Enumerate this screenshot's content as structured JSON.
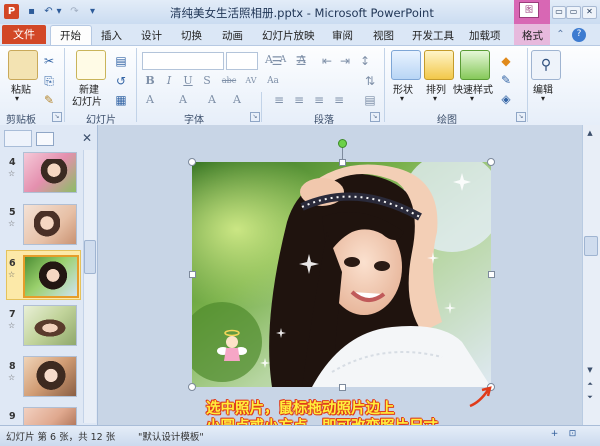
{
  "window": {
    "title": "清纯美女生活照相册.pptx - Microsoft PowerPoint",
    "app_icon": "P",
    "controls": {
      "minimize": "−",
      "restore": "▭",
      "close": "✕"
    },
    "context_tools_label": "图..."
  },
  "quick_access": {
    "save": "💾",
    "undo": "↶",
    "redo": "↷",
    "customize": "▾"
  },
  "tabs": [
    "文件",
    "开始",
    "插入",
    "设计",
    "切换",
    "动画",
    "幻灯片放映",
    "审阅",
    "视图",
    "开发工具",
    "加载项",
    "格式"
  ],
  "active_tab": "开始",
  "ribbon": {
    "clipboard": {
      "group": "剪贴板",
      "paste": "粘贴",
      "cut_icon": "✂",
      "copy_icon": "⎘",
      "painter_icon": "🖌"
    },
    "slides": {
      "group": "幻灯片",
      "new_slide": "新建",
      "new_slide_2": "幻灯片",
      "layout_icon": "▤",
      "reset_icon": "↺",
      "section_icon": "▦"
    },
    "font": {
      "group": "字体",
      "font_name": "",
      "font_size": "",
      "bold": "B",
      "italic": "I",
      "underline": "U",
      "strike": "S",
      "shadow": "abc",
      "spacing": "AV",
      "grow": "A",
      "shrink": "A",
      "clear": "A",
      "case": "Aa",
      "color": "A"
    },
    "paragraph": {
      "group": "段落"
    },
    "drawing": {
      "group": "绘图",
      "shape": "形状",
      "arrange": "排列",
      "quick_style": "快速样式"
    },
    "editing": {
      "group": "",
      "edit": "编辑"
    }
  },
  "slide_pane": {
    "slides": [
      {
        "num": "4",
        "star": "☆"
      },
      {
        "num": "5",
        "star": "☆"
      },
      {
        "num": "6",
        "star": "☆",
        "selected": true
      },
      {
        "num": "7",
        "star": "☆"
      },
      {
        "num": "8",
        "star": "☆"
      },
      {
        "num": "9",
        "star": "☆"
      }
    ],
    "close_icon": "✕"
  },
  "annotation": {
    "line1": "选中照片，鼠标拖动照片边上",
    "line2": "小圆点或小方点，即可改变照片尺寸"
  },
  "statusbar": {
    "slide_info": "幻灯片 第 6 张，共 12 张",
    "theme": "\"默认设计模板\"",
    "zoom_in": "+",
    "fit": "⊡"
  },
  "colors": {
    "file_tab": "#d24726",
    "format_tab": "#e7b9dd",
    "annotation_text": "#ffef3c",
    "annotation_outline": "#e03b1a"
  }
}
